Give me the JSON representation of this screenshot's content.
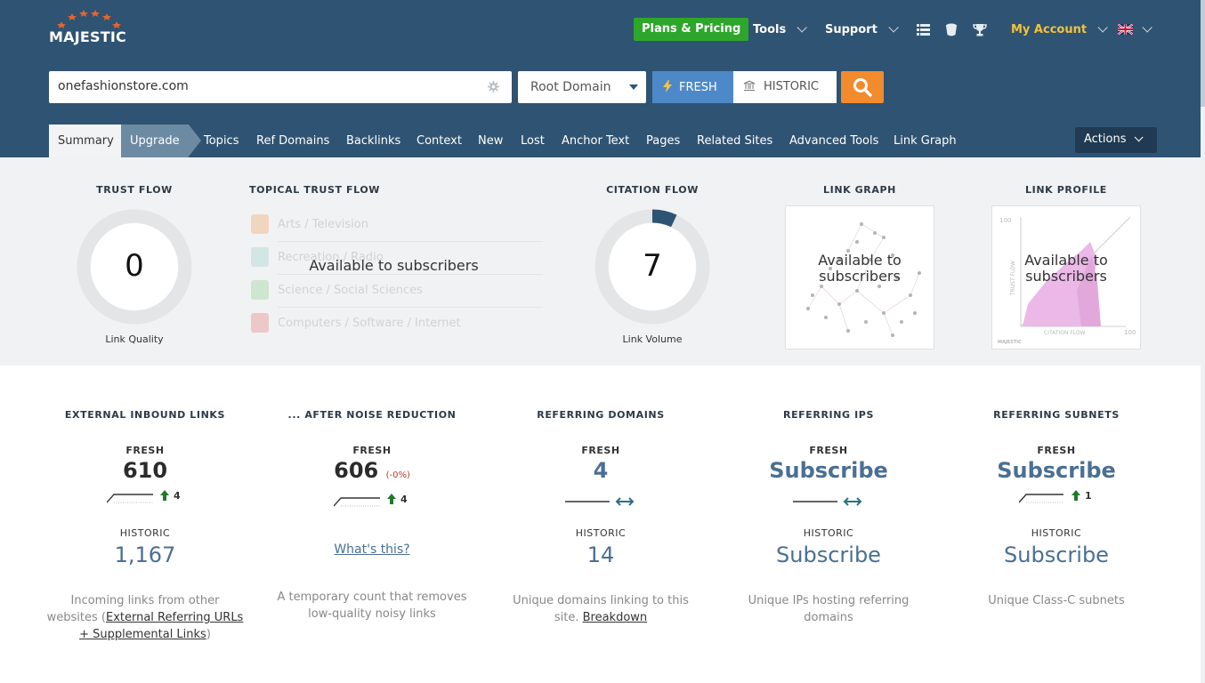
{
  "brand": {
    "name": "MAJESTIC",
    "star_color": "#e8642c"
  },
  "nav": {
    "plans_label": "Plans & Pricing",
    "tools_label": "Tools",
    "support_label": "Support",
    "account_label": "My Account",
    "icons": [
      "list-icon",
      "cup-icon",
      "trophy-icon",
      "uk-flag-icon"
    ]
  },
  "search": {
    "value": "onefashionstore.com",
    "scope": "Root Domain",
    "fresh_label": "FRESH",
    "historic_label": "HISTORIC"
  },
  "tabs": [
    "Summary",
    "Upgrade",
    "Topics",
    "Ref Domains",
    "Backlinks",
    "Context",
    "New",
    "Lost",
    "Anchor Text",
    "Pages",
    "Related Sites",
    "Advanced Tools",
    "Link Graph"
  ],
  "actions_label": "Actions",
  "metrics": {
    "trust_flow": {
      "title": "TRUST FLOW",
      "value": "0",
      "sub": "Link Quality"
    },
    "topical": {
      "title": "TOPICAL TRUST FLOW",
      "overlay": "Available to subscribers",
      "items": [
        {
          "label": "Arts / Television",
          "color": "#f0a060"
        },
        {
          "label": "Recreation / Radio",
          "color": "#9cd0d0"
        },
        {
          "label": "Science / Social Sciences",
          "color": "#8ed08e"
        },
        {
          "label": "Computers / Software / Internet",
          "color": "#e57d7d"
        }
      ]
    },
    "citation_flow": {
      "title": "CITATION FLOW",
      "value": "7",
      "sub": "Link Volume",
      "level": 0.07,
      "color": "#2f5372"
    },
    "link_graph": {
      "title": "LINK GRAPH",
      "overlay": "Available to subscribers"
    },
    "link_profile": {
      "title": "LINK PROFILE",
      "overlay": "Available to subscribers",
      "axis_y": "TRUST FLOW",
      "axis_x": "CITATION FLOW",
      "tick": "100",
      "mark": "MAJESTIC"
    }
  },
  "stats": [
    {
      "title": "EXTERNAL INBOUND LINKS",
      "fresh_label": "FRESH",
      "fresh": "610",
      "trend": "4",
      "historic_label": "HISTORIC",
      "historic": "1,167",
      "desc_pre": "Incoming links from other websites (",
      "desc_link": "External Referring URLs + Supplemental Links",
      "desc_post": ")"
    },
    {
      "title": "... AFTER NOISE REDUCTION",
      "fresh_label": "FRESH",
      "fresh": "606",
      "change": "(-0%)",
      "trend": "4",
      "whats": "What's this?",
      "desc_pre": "A temporary count that removes low-quality noisy links",
      "desc_link": "",
      "desc_post": ""
    },
    {
      "title": "REFERRING DOMAINS",
      "fresh_label": "FRESH",
      "fresh": "4",
      "historic_label": "HISTORIC",
      "historic": "14",
      "desc_pre": "Unique domains linking to this site. ",
      "desc_link": "Breakdown",
      "desc_post": ""
    },
    {
      "title": "REFERRING IPS",
      "fresh_label": "FRESH",
      "fresh": "Subscribe",
      "historic_label": "HISTORIC",
      "historic": "Subscribe",
      "desc_pre": "Unique IPs hosting referring domains",
      "desc_link": "",
      "desc_post": ""
    },
    {
      "title": "REFERRING SUBNETS",
      "fresh_label": "FRESH",
      "fresh": "Subscribe",
      "trend": "1",
      "historic_label": "HISTORIC",
      "historic": "Subscribe",
      "desc_pre": "Unique Class-C subnets",
      "desc_link": "",
      "desc_post": ""
    }
  ]
}
